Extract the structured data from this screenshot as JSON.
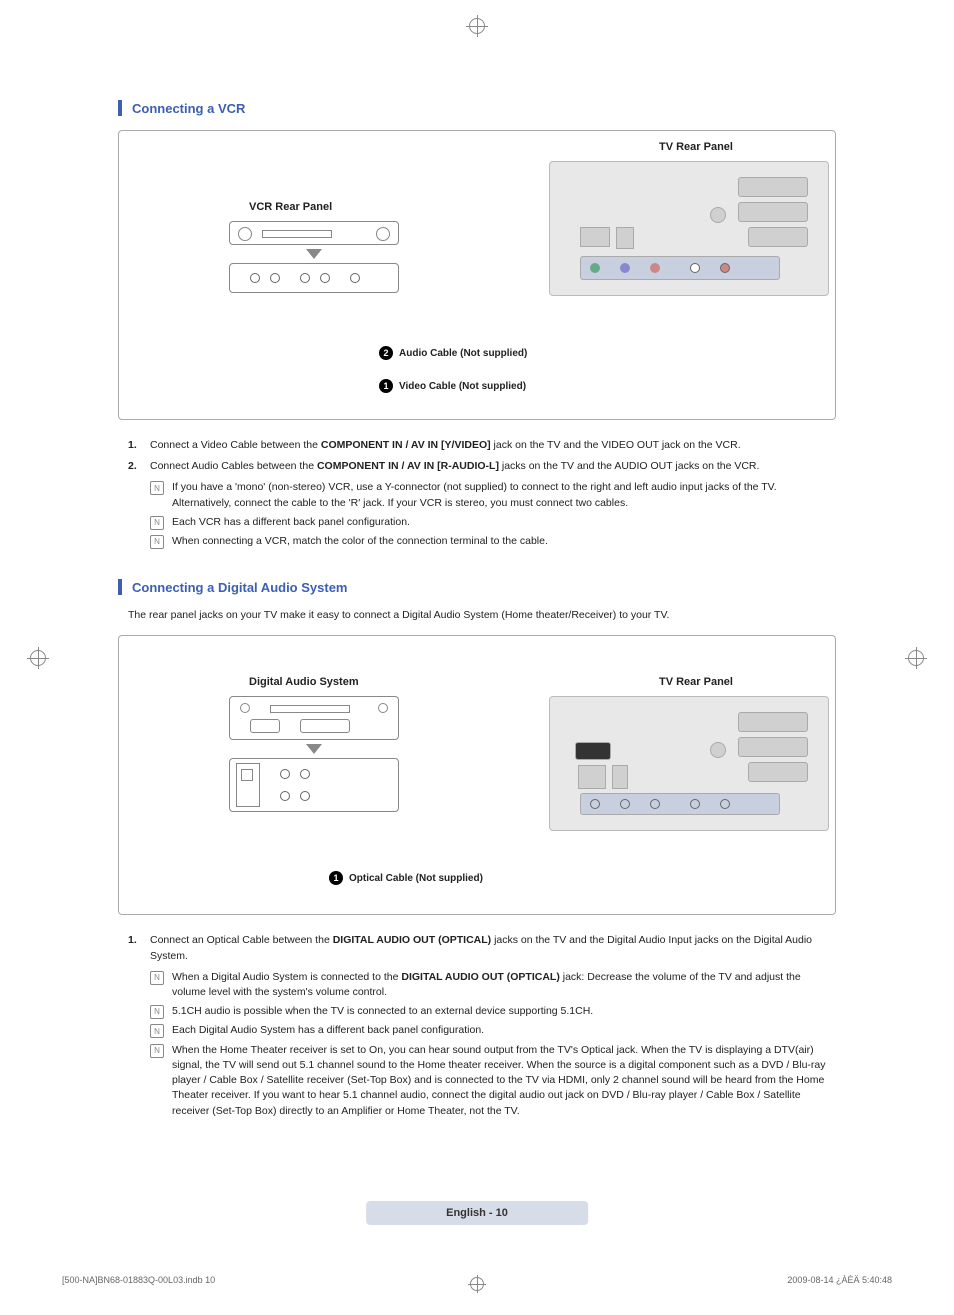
{
  "section1": {
    "title": "Connecting a VCR",
    "vcr_label": "VCR Rear Panel",
    "tv_label": "TV Rear Panel",
    "cable_audio": "Audio Cable (Not supplied)",
    "cable_video": "Video Cable (Not supplied)",
    "steps": [
      {
        "num": "1.",
        "text_parts": [
          "Connect a Video Cable between the ",
          "COMPONENT IN / AV IN  [Y/VIDEO]",
          " jack on the TV and the VIDEO OUT jack on the VCR."
        ]
      },
      {
        "num": "2.",
        "text_parts": [
          "Connect Audio Cables between the ",
          "COMPONENT IN / AV IN  [R-AUDIO-L]",
          " jacks on the TV and the AUDIO OUT jacks on the VCR."
        ]
      }
    ],
    "notes": [
      "If you have a 'mono' (non-stereo) VCR, use a Y-connector (not supplied) to connect to the right and left audio input jacks of the TV. Alternatively, connect the cable to the 'R' jack. If your VCR is stereo, you must connect two cables.",
      "Each VCR has a different back panel configuration.",
      "When connecting a VCR, match the color of the connection terminal to the cable."
    ]
  },
  "section2": {
    "title": "Connecting a Digital Audio System",
    "intro": "The rear panel jacks on your TV make it easy to connect a Digital Audio System (Home theater/Receiver) to your TV.",
    "das_label": "Digital Audio System",
    "tv_label": "TV Rear Panel",
    "cable_optical": "Optical Cable (Not supplied)",
    "steps": [
      {
        "num": "1.",
        "text_parts": [
          "Connect an Optical Cable between the ",
          "DIGITAL AUDIO OUT (OPTICAL)",
          " jacks on the TV and the Digital Audio Input jacks on the Digital Audio System."
        ]
      }
    ],
    "notes": [
      {
        "pre": "When a Digital Audio System is connected to the ",
        "bold": "DIGITAL AUDIO OUT (OPTICAL)",
        "post": " jack: Decrease the volume of the TV and adjust the volume level with the system's volume control."
      },
      {
        "plain": "5.1CH audio is possible when the TV is connected to an external device supporting 5.1CH."
      },
      {
        "plain": "Each Digital Audio System has a different back panel configuration."
      },
      {
        "plain": "When the Home Theater receiver is set to On, you can hear sound output from the TV's Optical jack. When the TV is displaying a DTV(air) signal, the TV will send out 5.1 channel sound to the Home theater receiver. When the source is a digital component such as a DVD / Blu-ray player / Cable Box / Satellite receiver (Set-Top Box) and is connected to the TV via HDMI, only 2 channel sound will be heard from the Home Theater receiver. If you want to hear 5.1 channel audio, connect the digital audio out jack on DVD / Blu-ray player / Cable Box / Satellite receiver (Set-Top Box) directly to an Amplifier or Home Theater, not the TV."
      }
    ]
  },
  "page_badge": "English - 10",
  "footer": {
    "left": "[500-NA]BN68-01883Q-00L03.indb   10",
    "right": "2009-08-14   ¿ÀÈÄ 5:40:48"
  },
  "note_icon": "N"
}
